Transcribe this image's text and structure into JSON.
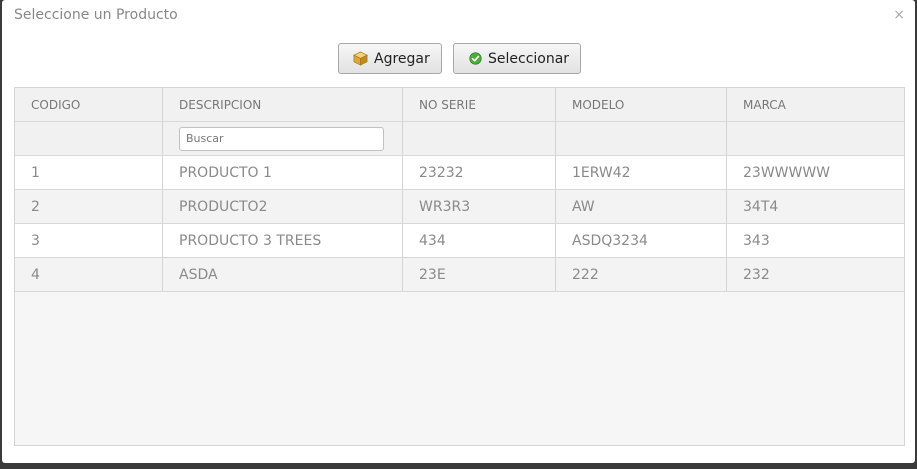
{
  "dialog": {
    "title": "Seleccione un Producto",
    "close_glyph": "×"
  },
  "toolbar": {
    "agregar_label": "Agregar",
    "agregar_icon": "box-icon",
    "seleccionar_label": "Seleccionar",
    "seleccionar_icon": "check-circle-icon"
  },
  "table": {
    "columns": [
      "CODIGO",
      "DESCRIPCION",
      "NO SERIE",
      "MODELO",
      "MARCA"
    ],
    "search_placeholder": "Buscar",
    "rows": [
      [
        "1",
        "PRODUCTO 1",
        "23232",
        "1ERW42",
        "23WWWWW"
      ],
      [
        "2",
        "PRODUCTO2",
        "WR3R3",
        "AW",
        "34T4"
      ],
      [
        "3",
        "PRODUCTO 3 TREES",
        "434",
        "ASDQ3234",
        "343"
      ],
      [
        "4",
        "ASDA",
        "23E",
        "222",
        "232"
      ]
    ]
  },
  "colors": {
    "check_green": "#4caf3a",
    "box_gold": "#d9a632"
  }
}
